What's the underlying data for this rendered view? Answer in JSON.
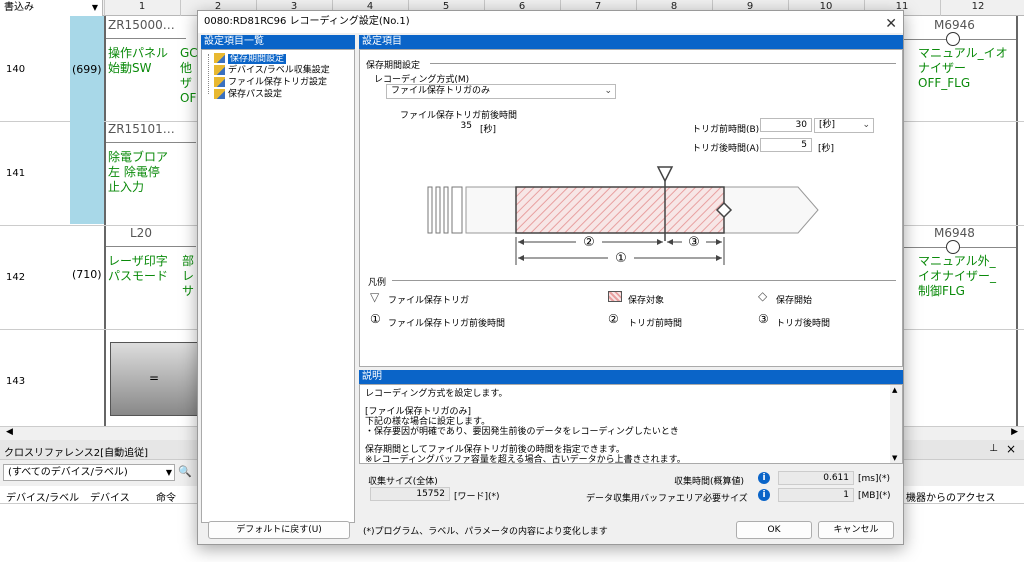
{
  "ladder": {
    "mode": "書込み",
    "columns": [
      "1",
      "2",
      "3",
      "4",
      "5",
      "6",
      "7",
      "8",
      "9",
      "10",
      "11",
      "12"
    ],
    "rows": [
      {
        "num": "140",
        "step": "(699)",
        "contact": "ZR15000…",
        "label": "操作パネル\n始動SW",
        "partial": "GC\n他\nザ\nOF",
        "coil": "M6946",
        "coil_label": "マニュアル_イオ\nナイザー\nOFF_FLG"
      },
      {
        "num": "141",
        "step": "",
        "contact": "ZR15101…",
        "label": "除電ブロア\n左 除電停\n止入力",
        "partial": "",
        "coil": "",
        "coil_label": ""
      },
      {
        "num": "142",
        "step": "(710)",
        "contact": "L20",
        "label": "レーザ印字\nパスモード",
        "partial": "部\nレ\nサ",
        "coil": "M6948",
        "coil_label": "マニュアル外_\nイオナイザー_\n制御FLG"
      },
      {
        "num": "143",
        "step": "",
        "contact": "",
        "label": "",
        "partial": "",
        "coil": "",
        "coil_label": ""
      }
    ],
    "compare_op": "="
  },
  "bottom_panel": {
    "title": "クロスリファレンス2[自動追従]",
    "filter_value": "(すべてのデバイス/ラベル)",
    "headers": [
      "デバイス/ラベル",
      "デバイス",
      "命令"
    ],
    "right_header": "機器からのアクセス",
    "pin_icon": "pin-icon"
  },
  "dialog": {
    "title": "0080:RD81RC96 レコーディング設定(No.1)",
    "tree_header": "設定項目一覧",
    "tree_items": [
      "保存期間設定",
      "デバイス/ラベル収集設定",
      "ファイル保存トリガ設定",
      "保存パス設定"
    ],
    "settings_header": "設定項目",
    "group_title": "保存期間設定",
    "recording_method_label": "レコーディング方式(M)",
    "recording_method_value": "ファイル保存トリガのみ",
    "trigger_window_label": "ファイル保存トリガ前後時間",
    "trigger_window_value": "35",
    "trigger_window_unit": "[秒]",
    "pre_trigger_label": "トリガ前時間(B)",
    "pre_trigger_value": "30",
    "pre_trigger_unit": "[秒]",
    "post_trigger_label": "トリガ後時間(A)",
    "post_trigger_value": "5",
    "post_trigger_unit": "[秒]",
    "diagram": {
      "marker2": "②",
      "marker3": "③",
      "marker1": "①"
    },
    "legend_title": "凡例",
    "legend": [
      {
        "symbol": "▽",
        "text": "ファイル保存トリガ"
      },
      {
        "symbol": "",
        "text": "保存対象"
      },
      {
        "symbol": "◇",
        "text": "保存開始"
      },
      {
        "symbol": "①",
        "text": "ファイル保存トリガ前後時間"
      },
      {
        "symbol": "②",
        "text": "トリガ前時間"
      },
      {
        "symbol": "③",
        "text": "トリガ後時間"
      }
    ],
    "desc_header": "説明",
    "description": [
      "レコーディング方式を設定します。",
      "",
      "[ファイル保存トリガのみ]",
      "下記の様な場合に設定します。",
      "・保存要因が明確であり、要因発生前後のデータをレコーディングしたいとき",
      "",
      "保存期間としてファイル保存トリガ前後の時間を指定できます。",
      "※レコーディングバッファ容量を超える場合、古いデータから上書きされます。"
    ],
    "collect_size_label": "収集サイズ(全体)",
    "collect_size_value": "15752",
    "collect_size_unit": "[ワード](*)",
    "collect_time_label": "収集時間(概算値)",
    "collect_time_value": "0.611",
    "collect_time_unit": "[ms](*)",
    "buffer_label": "データ収集用バッファエリア必要サイズ",
    "buffer_value": "1",
    "buffer_unit": "[MB](*)",
    "default_button": "デフォルトに戻す(U)",
    "footnote": "(*)プログラム、ラベル、パラメータの内容により変化します",
    "ok_button": "OK",
    "cancel_button": "キャンセル"
  },
  "colors": {
    "accent": "#0a64c8",
    "green": "#0a8a0a",
    "hatch": "#e8a0a0"
  }
}
